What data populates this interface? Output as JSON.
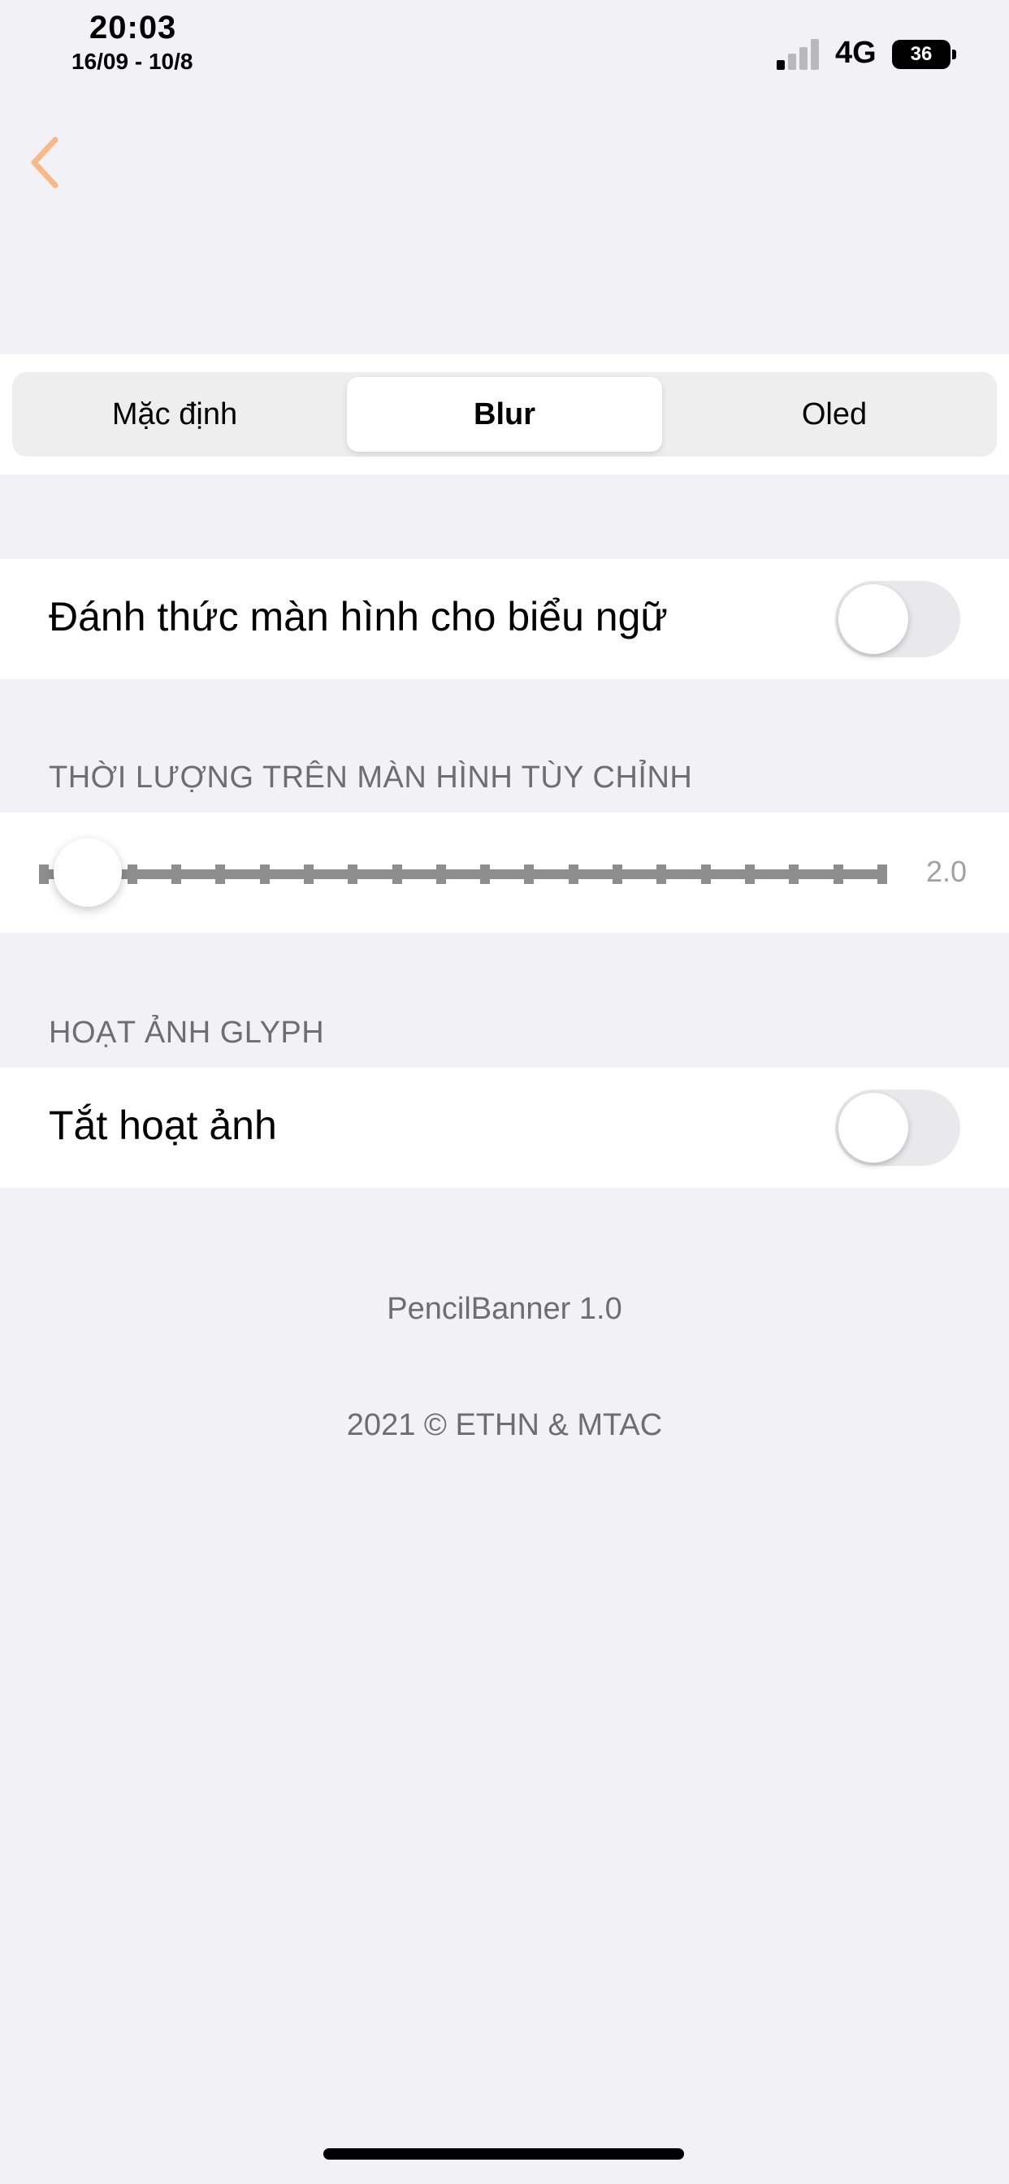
{
  "status_bar": {
    "time": "20:03",
    "date": "16/09 - 10/8",
    "network": "4G",
    "battery": "36",
    "signal_bars_active": 1
  },
  "nav": {
    "back_icon": "chevron-left-icon",
    "accent_color": "#f5b98a"
  },
  "style_segments": {
    "options": [
      "Mặc định",
      "Blur",
      "Oled"
    ],
    "selected": "Blur"
  },
  "wake_screen": {
    "label": "Đánh thức màn hình cho biểu ngữ",
    "enabled": false
  },
  "duration": {
    "header": "THỜI LƯỢNG TRÊN MÀN HÌNH TÙY CHỈNH",
    "value": "2.0",
    "position_fraction": 0.0
  },
  "glyph_animation": {
    "header": "HOẠT ẢNH GLYPH",
    "label": "Tắt hoạt ảnh",
    "enabled": false
  },
  "footer": {
    "version": "PencilBanner 1.0",
    "copyright": "2021 © ETHN & MTAC"
  }
}
